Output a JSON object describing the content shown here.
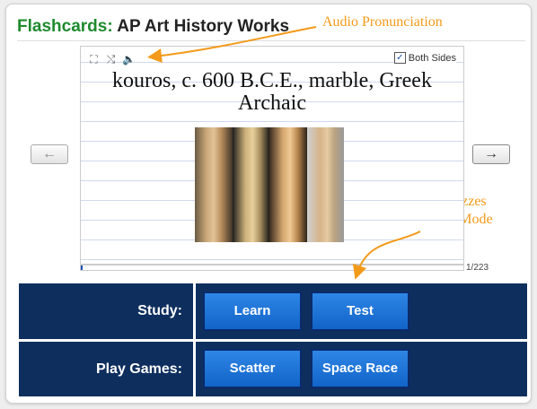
{
  "header": {
    "title_prefix": "Flashcards:",
    "title": "AP Art History Works"
  },
  "annotations": {
    "audio": "Audio Pronunciation",
    "quizzes_line1": "Create Quizzes",
    "quizzes_line2": "with Study Mode"
  },
  "card": {
    "text": "kouros, c. 600 B.C.E., marble, Greek Archaic",
    "both_sides_label": "Both Sides",
    "both_sides_checked": "✓",
    "icons": [
      "fullscreen-icon",
      "shuffle-icon",
      "speaker-icon"
    ],
    "icon_glyphs": {
      "fullscreen": "⛶",
      "shuffle": "⤭",
      "speaker": "🔈"
    }
  },
  "navigation": {
    "prev_glyph": "←",
    "next_glyph": "→",
    "counter": "1/223",
    "progress_fraction": 0.0045
  },
  "study": {
    "label": "Study:",
    "buttons": [
      "Learn",
      "Test"
    ]
  },
  "games": {
    "label": "Play Games:",
    "buttons": [
      "Scatter",
      "Space Race"
    ]
  },
  "colors": {
    "title_green": "#1f8a2e",
    "annotation_orange": "#f39a1a",
    "panel_navy": "#0e2f5e",
    "button_blue": "#1a74d8"
  }
}
